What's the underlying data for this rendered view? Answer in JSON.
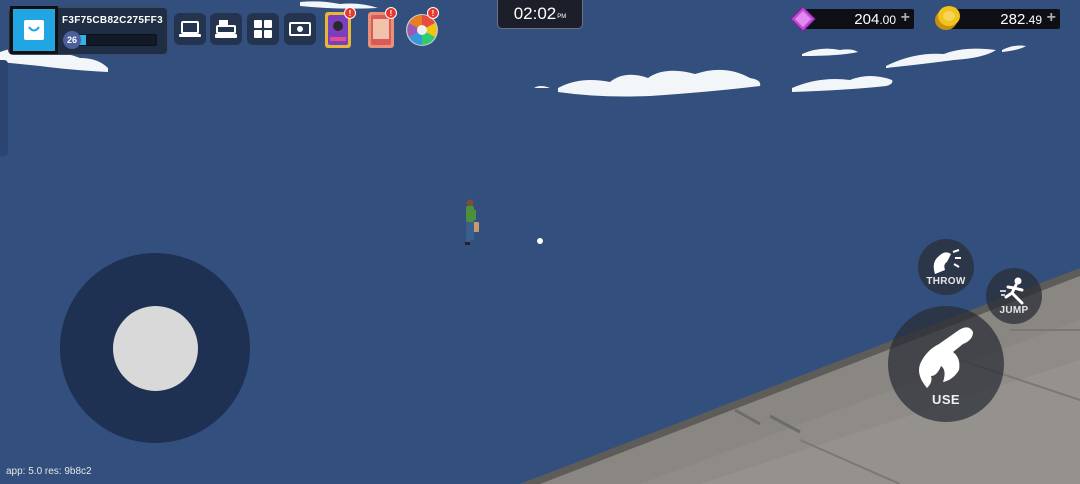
{
  "player": {
    "id": "F3F75CB82C275FF3",
    "level": "26",
    "xp_progress": 0.12
  },
  "toolbar": {
    "items": [
      {
        "name": "laptop-icon"
      },
      {
        "name": "cash-register-icon"
      },
      {
        "name": "grid-icon"
      },
      {
        "name": "money-icon"
      }
    ],
    "events": [
      {
        "name": "event-card-icon",
        "alert": "!"
      },
      {
        "name": "calendar-card-icon",
        "alert": "!"
      },
      {
        "name": "prize-wheel-icon",
        "alert": "!"
      }
    ]
  },
  "clock": {
    "time": "02:02",
    "ampm": "PM"
  },
  "currency": {
    "gems_whole": "204",
    "gems_decimal": ".00",
    "coins_whole": "282",
    "coins_decimal": ".49",
    "plus": "+"
  },
  "controls": {
    "throw_label": "THROW",
    "jump_label": "JUMP",
    "use_label": "USE"
  },
  "footer": {
    "version": "app: 5.0 res: 9b8c2"
  },
  "colors": {
    "sky": "#324f7d",
    "gem": "#c04ad8",
    "coin": "#f2c21d",
    "shop": "#22a5e3",
    "alert": "#e8382e"
  }
}
